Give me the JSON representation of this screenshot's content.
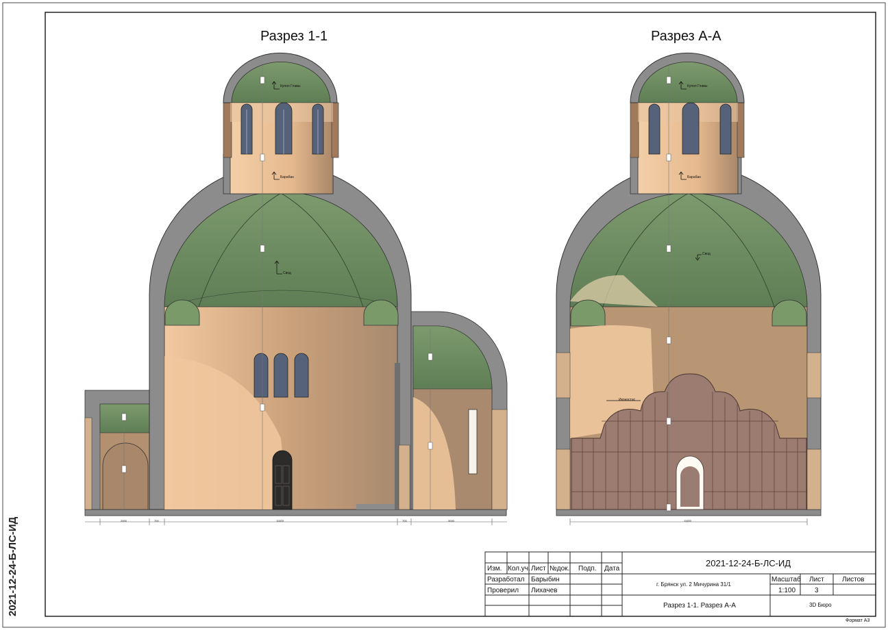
{
  "sheet": {
    "code": "2021-12-24-Б-ЛС-ИД",
    "format": "Формат А3"
  },
  "section_left": {
    "title": "Разрез 1-1",
    "labels": {
      "kupol": "Купол Главы",
      "baraban": "Барабан",
      "svod": "Свод"
    },
    "dims": [
      "2000",
      "700",
      "11000",
      "700",
      "3000"
    ]
  },
  "section_right": {
    "title": "Разрез А-А",
    "labels": {
      "kupol": "Купол Главы",
      "baraban": "Барабан",
      "svod": "Свод",
      "iconostasis": "Иконостас"
    },
    "dims": [
      "11000"
    ]
  },
  "title_block": {
    "doc_code": "2021-12-24-Б-ЛС-ИД",
    "headers": {
      "izm": "Изм.",
      "kol": "Кол.уч.",
      "list": "Лист",
      "ndok": "№док.",
      "podp": "Подп.",
      "data": "Дата"
    },
    "rows": [
      {
        "role": "Разработал",
        "name": "Барыбин"
      },
      {
        "role": "Проверил",
        "name": "Лихачев"
      }
    ],
    "address": "г. Брянск ул. 2 Мичурина 31/1",
    "sheet_title": "Разрез 1-1. Разрез А-А",
    "scale_label": "Масштаб",
    "scale_value": "1:100",
    "list_label": "Лист",
    "list_value": "3",
    "listov_label": "Листов",
    "listov_value": "",
    "company": "3D Бюро"
  }
}
